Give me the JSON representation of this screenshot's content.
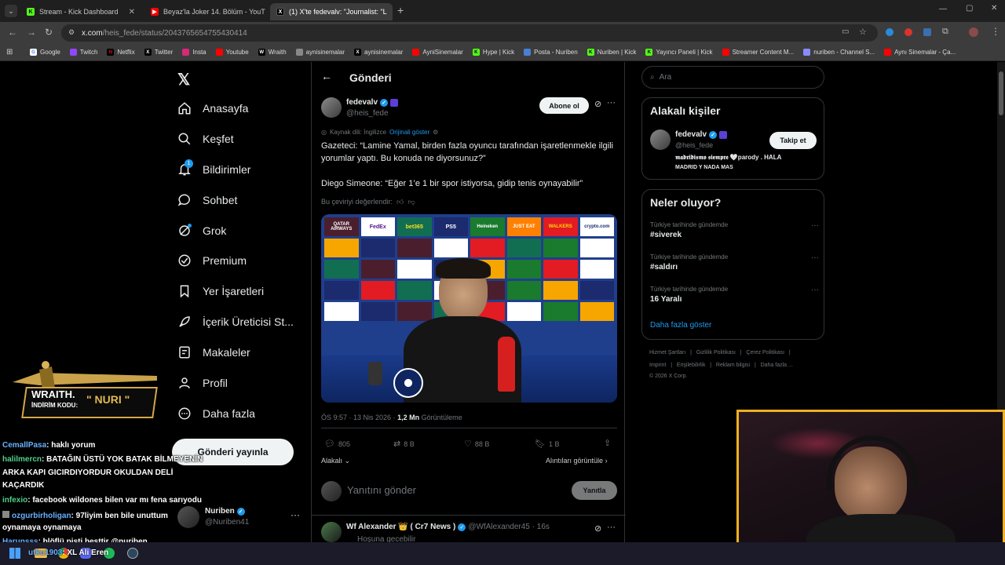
{
  "browser": {
    "tabs": [
      {
        "title": "Stream - Kick Dashboard",
        "icon": "kick-icon",
        "active": false
      },
      {
        "title": "Beyaz'la Joker 14. Bölüm - YouT",
        "icon": "youtube-icon",
        "active": false
      },
      {
        "title": "(1) X'te fedevalv: \"Journalist: \"L",
        "icon": "x-logo-icon",
        "active": true
      }
    ],
    "new_tab": "+",
    "url_domain": "x.com",
    "url_path": "/heis_fede/status/2043765654755430414",
    "bookmarks": [
      "Google",
      "Twitch",
      "Netflix",
      "Twitter",
      "Insta",
      "Youtube",
      "Wraith",
      "aynisinemalar",
      "aynisinemalar",
      "AyniSinemalar",
      "Hype | Kick",
      "Posta - Nuriben",
      "Nuriben | Kick",
      "Yayıncı Paneli | Kick",
      "Streamer Content M...",
      "nuriben - Channel S...",
      "Aynı Sinemalar - Ça..."
    ]
  },
  "sidebar": {
    "items": [
      {
        "label": "Anasayfa",
        "icon": "home-icon"
      },
      {
        "label": "Keşfet",
        "icon": "search-icon"
      },
      {
        "label": "Bildirimler",
        "icon": "bell-icon",
        "badge": "1"
      },
      {
        "label": "Sohbet",
        "icon": "chat-icon"
      },
      {
        "label": "Grok",
        "icon": "grok-icon"
      },
      {
        "label": "Premium",
        "icon": "premium-icon"
      },
      {
        "label": "Yer İşaretleri",
        "icon": "bookmark-icon"
      },
      {
        "label": "İçerik Üreticisi St...",
        "icon": "rocket-icon"
      },
      {
        "label": "Makaleler",
        "icon": "article-icon"
      },
      {
        "label": "Profil",
        "icon": "person-icon"
      },
      {
        "label": "Daha fazla",
        "icon": "more-circle-icon"
      }
    ],
    "post_button": "Gönderi yayınla",
    "account": {
      "name": "Nuriben",
      "handle": "@Nuriben41"
    }
  },
  "post": {
    "header": "Gönderi",
    "author_name": "fedevalv",
    "author_handle": "@heis_fede",
    "subscribe_label": "Abone ol",
    "source_lang": "Kaynak dili: İngilizce",
    "show_original": "Orijinali göster",
    "text_1": "Gazeteci: “Lamine Yamal, birden fazla oyuncu tarafından işaretlenmekle ilgili yorumlar yaptı. Bu konuda ne diyorsunuz?”",
    "text_2": "Diego Simeone: “Eğer 1’e 1 bir spor istiyorsa, gidip tenis oynayabilir”",
    "rate_translation": "Bu çeviriyi değerlendir:",
    "meta_time": "ÖS 9:57 · 13 Nis 2026 · ",
    "views": "1,2 Mn",
    "views_label": " Görüntüleme",
    "stats": {
      "replies": "805",
      "reposts": "8 B",
      "likes": "88 B",
      "bookmarks": "1 B"
    },
    "relevant": "Alakalı",
    "quotes": "Alıntıları görüntüle",
    "reply_placeholder": "Yanıtını gönder",
    "reply_button": "Yanıtla",
    "sponsor_boards": [
      "QATAR AIRWAYS",
      "FedEx",
      "bet365",
      "PS5",
      "Heineken",
      "JUST EAT",
      "WALKERS",
      "crypto.com"
    ]
  },
  "reply": {
    "name": "Wf Alexander 👑 ( Cr7 News )",
    "handle": "@WfAlexander45 · 16s",
    "text": "Hoşuna gecebilir"
  },
  "right": {
    "search_placeholder": "Ara",
    "relevant_title": "Alakalı kişiler",
    "person": {
      "name": "fedevalv",
      "handle": "@heis_fede",
      "follow": "Takip et",
      "bio_1": "𝖒𝖆𝖉𝖗𝖎𝖉𝖎𝖘𝖒𝖔 𝖘𝖎𝖊𝖒𝖕𝖗𝖊 🤍parody . HALA",
      "bio_2": "MADRID Y NADA MAS"
    },
    "trends_title": "Neler oluyor?",
    "trends": [
      {
        "context": "Türkiye tarihinde gündemde",
        "name": "#siverek"
      },
      {
        "context": "Türkiye tarihinde gündemde",
        "name": "#saldırı"
      },
      {
        "context": "Türkiye tarihinde gündemde",
        "name": "16 Yaralı"
      }
    ],
    "show_more": "Daha fazla göster",
    "footer_1": "Hizmet Şartları   |   Gizlilik Politikası   |   Çerez Politikası   |",
    "footer_2": "Imprint   |   Erişilebilirlik   |   Reklam bilgisi   |   Daha fazla ...",
    "footer_3": "© 2026 X Corp."
  },
  "overlay": {
    "promo_brand": "WRAITH.",
    "promo_label": "İNDİRİM KODU:",
    "promo_code": "\" NURI \"",
    "chat": [
      {
        "user": "CemallPasa",
        "color": "#6ab0ff",
        "msg": ": haklı yorum"
      },
      {
        "user": "halilmercn",
        "color": "#4fd18b",
        "msg": ": BATAĞIN ÜSTÜ YOK BATAK BİLMEYENİN"
      },
      {
        "user": "",
        "color": "#fff",
        "msg": "ARKA KAPI GICIRDIYORDUR OKULDAN DELİ"
      },
      {
        "user": "",
        "color": "#fff",
        "msg": "KAÇARDIK"
      },
      {
        "user": "infexio",
        "color": "#4fd18b",
        "msg": ": facebook wildones bilen var mı fena sarıyodu"
      },
      {
        "user": "ozgurbirholigan",
        "color": "#6ab0ff",
        "msg": ": 97liyim ben bile unuttum"
      },
      {
        "user": "",
        "color": "#fff",
        "msg": "oynamaya oynamaya"
      },
      {
        "user": "Harunsss",
        "color": "#6ab0ff",
        "msg": ": blöflü pişti besttir @nuriben"
      },
      {
        "user": "utku1903",
        "color": "#6ab0ff",
        "msg": ": XL Ali Eren"
      }
    ]
  }
}
